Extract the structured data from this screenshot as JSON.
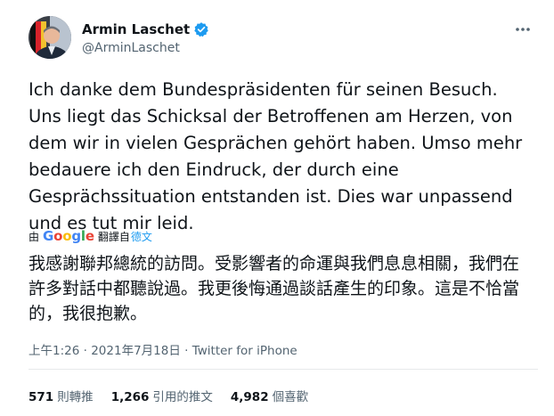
{
  "author": {
    "display_name": "Armin Laschet",
    "handle": "@ArminLaschet"
  },
  "icons": {
    "verified": "verified-badge-icon",
    "more": "more-options-icon",
    "avatar": "profile-avatar"
  },
  "tweet": {
    "text": "Ich danke dem Bundespräsidenten für seinen Besuch. Uns liegt das Schicksal der Betroffenen am Herzen, von dem wir in vielen Gesprächen gehört haben. Umso mehr bedauere ich den Eindruck, der durch eine Gesprächssituation entstanden ist. Dies war unpassend und es tut mir leid.",
    "translate_by": "由",
    "translate_provider": "Google",
    "translate_action": "翻譯自",
    "translate_language": "德文",
    "translated_text": "我感謝聯邦總統的訪問。受影響者的命運與我們息息相關，我們在許多對話中都聽說過。我更後悔通過談話產生的印象。這是不恰當的，我很抱歉。"
  },
  "meta": {
    "time": "上午1:26",
    "separator": "·",
    "date": "2021年7月18日",
    "source": "Twitter for iPhone"
  },
  "stats": {
    "retweets_count": "571",
    "retweets_label": "則轉推",
    "quotes_count": "1,266",
    "quotes_label": "引用的推文",
    "likes_count": "4,982",
    "likes_label": "個喜歡"
  },
  "colors": {
    "text": "#0f1419",
    "secondary": "#536471",
    "link": "#1d9bf0",
    "verified": "#1d9bf0",
    "divider": "#e7e9ea"
  }
}
